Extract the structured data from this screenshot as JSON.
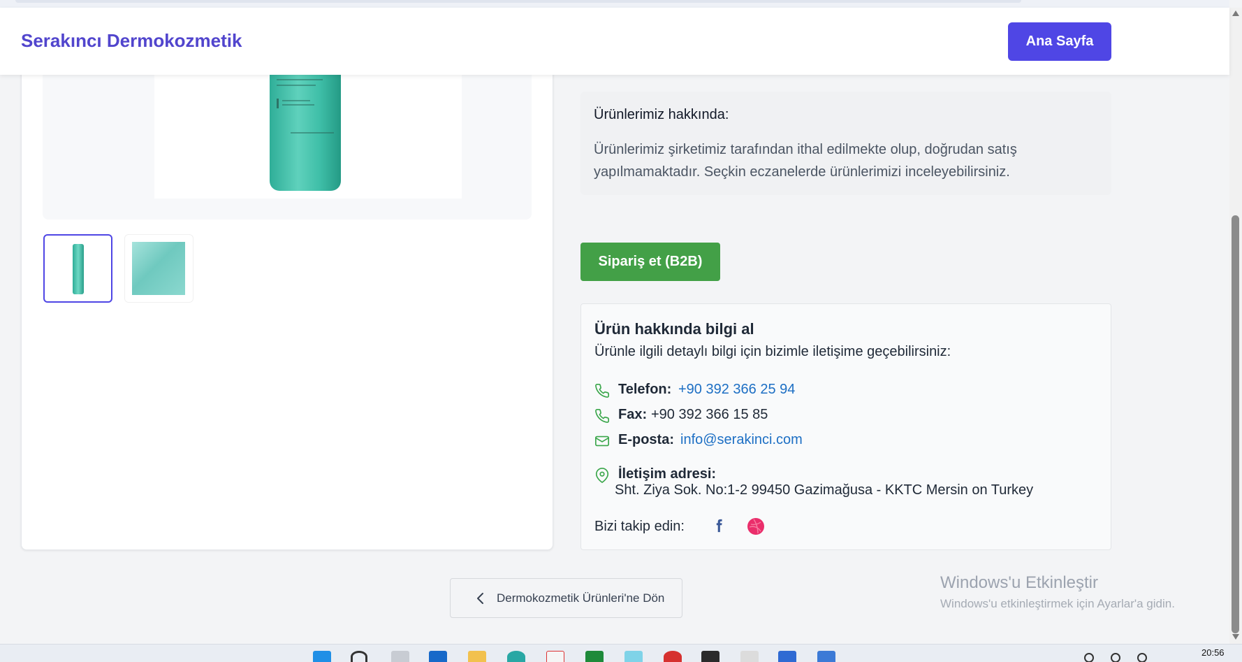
{
  "header": {
    "brand": "Serakıncı Dermokozmetik",
    "home_button": "Ana Sayfa"
  },
  "info_box": {
    "title": "Ürünlerimiz hakkında:",
    "text": "Ürünlerimiz şirketimiz tarafından ithal edilmekte olup, doğrudan satış yapılmamaktadır. Seçkin eczanelerde ürünlerimizi inceleyebilirsiniz."
  },
  "order_button": "Sipariş et (B2B)",
  "contact": {
    "title": "Ürün hakkında bilgi al",
    "description": "Ürünle ilgili detaylı bilgi için bizimle iletişime geçebilirsiniz:",
    "phone_label": "Telefon:",
    "phone_value": "+90 392 366 25 94",
    "fax_label": "Fax:",
    "fax_value": "+90 392 366 15 85",
    "email_label": "E-posta:",
    "email_value": "info@serakinci.com",
    "address_label": "İletişim adresi:",
    "address_value": "Sht. Ziya Sok. No:1-2 99450 Gazimağusa - KKTC Mersin on Turkey",
    "follow_label": "Bizi takip edin:"
  },
  "back_button": "Dermokozmetik Ürünleri'ne Dön",
  "watermark": {
    "title": "Windows'u Etkinleştir",
    "subtitle": "Windows'u etkinleştirmek için Ayarlar'a gidin."
  },
  "taskbar": {
    "time": "20:56"
  },
  "colors": {
    "brand": "#5145cd",
    "primary_button": "#4f46e5",
    "order_button": "#43a047",
    "link": "#1d6fc4",
    "contact_icon": "#3aa64a"
  },
  "icons": {
    "phone": "phone-icon",
    "fax": "fax-icon",
    "email": "mail-icon",
    "address": "map-pin-icon",
    "facebook": "facebook-icon",
    "social": "dribbble-icon",
    "back": "chevron-left-icon"
  }
}
